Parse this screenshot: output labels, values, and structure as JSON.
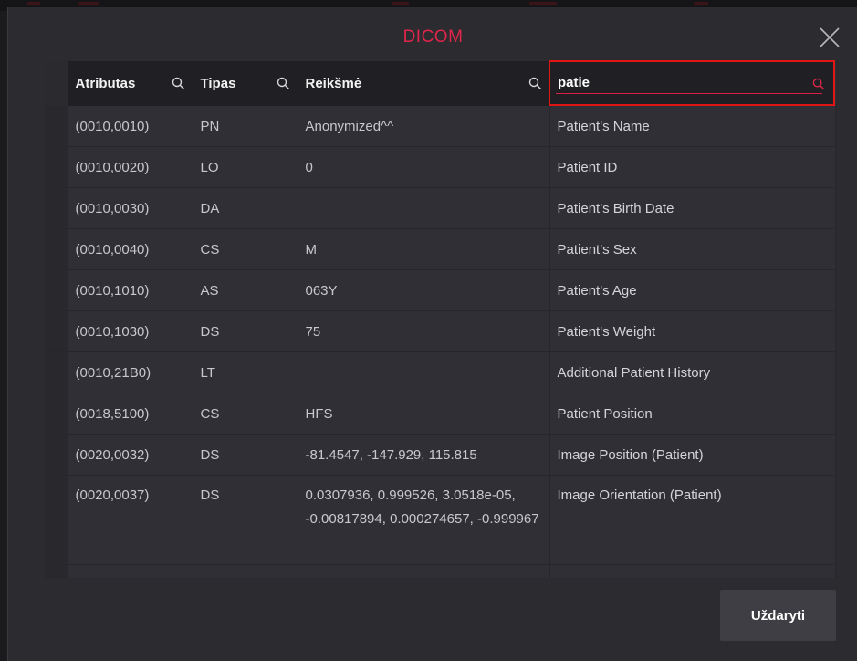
{
  "dialog": {
    "title": "DICOM",
    "close_icon": "close-icon"
  },
  "table": {
    "columns": [
      {
        "label": "Atributas",
        "icon": "search-icon"
      },
      {
        "label": "Tipas",
        "icon": "search-icon"
      },
      {
        "label": "Reikšmė",
        "icon": "search-icon"
      }
    ],
    "search": {
      "value": "patie",
      "icon": "search-icon",
      "accent_color": "#e01616"
    },
    "rows": [
      {
        "attr": "(0010,0010)",
        "type": "PN",
        "value": "Anonymized^^",
        "desc": "Patient's Name"
      },
      {
        "attr": "(0010,0020)",
        "type": "LO",
        "value": "0",
        "desc": "Patient ID"
      },
      {
        "attr": "(0010,0030)",
        "type": "DA",
        "value": "",
        "desc": "Patient's Birth Date"
      },
      {
        "attr": "(0010,0040)",
        "type": "CS",
        "value": "M",
        "desc": "Patient's Sex"
      },
      {
        "attr": "(0010,1010)",
        "type": "AS",
        "value": "063Y",
        "desc": "Patient's Age"
      },
      {
        "attr": "(0010,1030)",
        "type": "DS",
        "value": "75",
        "desc": "Patient's Weight"
      },
      {
        "attr": "(0010,21B0)",
        "type": "LT",
        "value": "",
        "desc": "Additional Patient History"
      },
      {
        "attr": "(0018,5100)",
        "type": "CS",
        "value": "HFS",
        "desc": "Patient Position"
      },
      {
        "attr": "(0020,0032)",
        "type": "DS",
        "value": "-81.4547, -147.929, 115.815",
        "desc": "Image Position (Patient)"
      },
      {
        "attr": "(0020,0037)",
        "type": "DS",
        "value": "0.0307936, 0.999526, 3.0518e-05, -0.00817894, 0.000274657, -0.999967",
        "desc": "Image Orientation (Patient)"
      }
    ]
  },
  "footer": {
    "close_label": "Uždaryti"
  },
  "colors": {
    "title": "#e0264a",
    "modal_bg": "#2b2b30",
    "header_bg": "#202024"
  }
}
